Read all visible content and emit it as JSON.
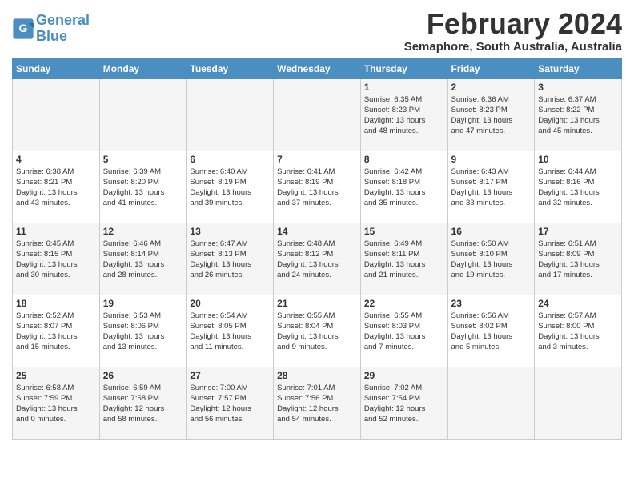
{
  "app": {
    "logo_line1": "General",
    "logo_line2": "Blue"
  },
  "header": {
    "month": "February 2024",
    "location": "Semaphore, South Australia, Australia"
  },
  "days_of_week": [
    "Sunday",
    "Monday",
    "Tuesday",
    "Wednesday",
    "Thursday",
    "Friday",
    "Saturday"
  ],
  "weeks": [
    [
      {
        "day": "",
        "info": ""
      },
      {
        "day": "",
        "info": ""
      },
      {
        "day": "",
        "info": ""
      },
      {
        "day": "",
        "info": ""
      },
      {
        "day": "1",
        "info": "Sunrise: 6:35 AM\nSunset: 8:23 PM\nDaylight: 13 hours\nand 48 minutes."
      },
      {
        "day": "2",
        "info": "Sunrise: 6:36 AM\nSunset: 8:23 PM\nDaylight: 13 hours\nand 47 minutes."
      },
      {
        "day": "3",
        "info": "Sunrise: 6:37 AM\nSunset: 8:22 PM\nDaylight: 13 hours\nand 45 minutes."
      }
    ],
    [
      {
        "day": "4",
        "info": "Sunrise: 6:38 AM\nSunset: 8:21 PM\nDaylight: 13 hours\nand 43 minutes."
      },
      {
        "day": "5",
        "info": "Sunrise: 6:39 AM\nSunset: 8:20 PM\nDaylight: 13 hours\nand 41 minutes."
      },
      {
        "day": "6",
        "info": "Sunrise: 6:40 AM\nSunset: 8:19 PM\nDaylight: 13 hours\nand 39 minutes."
      },
      {
        "day": "7",
        "info": "Sunrise: 6:41 AM\nSunset: 8:19 PM\nDaylight: 13 hours\nand 37 minutes."
      },
      {
        "day": "8",
        "info": "Sunrise: 6:42 AM\nSunset: 8:18 PM\nDaylight: 13 hours\nand 35 minutes."
      },
      {
        "day": "9",
        "info": "Sunrise: 6:43 AM\nSunset: 8:17 PM\nDaylight: 13 hours\nand 33 minutes."
      },
      {
        "day": "10",
        "info": "Sunrise: 6:44 AM\nSunset: 8:16 PM\nDaylight: 13 hours\nand 32 minutes."
      }
    ],
    [
      {
        "day": "11",
        "info": "Sunrise: 6:45 AM\nSunset: 8:15 PM\nDaylight: 13 hours\nand 30 minutes."
      },
      {
        "day": "12",
        "info": "Sunrise: 6:46 AM\nSunset: 8:14 PM\nDaylight: 13 hours\nand 28 minutes."
      },
      {
        "day": "13",
        "info": "Sunrise: 6:47 AM\nSunset: 8:13 PM\nDaylight: 13 hours\nand 26 minutes."
      },
      {
        "day": "14",
        "info": "Sunrise: 6:48 AM\nSunset: 8:12 PM\nDaylight: 13 hours\nand 24 minutes."
      },
      {
        "day": "15",
        "info": "Sunrise: 6:49 AM\nSunset: 8:11 PM\nDaylight: 13 hours\nand 21 minutes."
      },
      {
        "day": "16",
        "info": "Sunrise: 6:50 AM\nSunset: 8:10 PM\nDaylight: 13 hours\nand 19 minutes."
      },
      {
        "day": "17",
        "info": "Sunrise: 6:51 AM\nSunset: 8:09 PM\nDaylight: 13 hours\nand 17 minutes."
      }
    ],
    [
      {
        "day": "18",
        "info": "Sunrise: 6:52 AM\nSunset: 8:07 PM\nDaylight: 13 hours\nand 15 minutes."
      },
      {
        "day": "19",
        "info": "Sunrise: 6:53 AM\nSunset: 8:06 PM\nDaylight: 13 hours\nand 13 minutes."
      },
      {
        "day": "20",
        "info": "Sunrise: 6:54 AM\nSunset: 8:05 PM\nDaylight: 13 hours\nand 11 minutes."
      },
      {
        "day": "21",
        "info": "Sunrise: 6:55 AM\nSunset: 8:04 PM\nDaylight: 13 hours\nand 9 minutes."
      },
      {
        "day": "22",
        "info": "Sunrise: 6:55 AM\nSunset: 8:03 PM\nDaylight: 13 hours\nand 7 minutes."
      },
      {
        "day": "23",
        "info": "Sunrise: 6:56 AM\nSunset: 8:02 PM\nDaylight: 13 hours\nand 5 minutes."
      },
      {
        "day": "24",
        "info": "Sunrise: 6:57 AM\nSunset: 8:00 PM\nDaylight: 13 hours\nand 3 minutes."
      }
    ],
    [
      {
        "day": "25",
        "info": "Sunrise: 6:58 AM\nSunset: 7:59 PM\nDaylight: 13 hours\nand 0 minutes."
      },
      {
        "day": "26",
        "info": "Sunrise: 6:59 AM\nSunset: 7:58 PM\nDaylight: 12 hours\nand 58 minutes."
      },
      {
        "day": "27",
        "info": "Sunrise: 7:00 AM\nSunset: 7:57 PM\nDaylight: 12 hours\nand 56 minutes."
      },
      {
        "day": "28",
        "info": "Sunrise: 7:01 AM\nSunset: 7:56 PM\nDaylight: 12 hours\nand 54 minutes."
      },
      {
        "day": "29",
        "info": "Sunrise: 7:02 AM\nSunset: 7:54 PM\nDaylight: 12 hours\nand 52 minutes."
      },
      {
        "day": "",
        "info": ""
      },
      {
        "day": "",
        "info": ""
      }
    ]
  ]
}
